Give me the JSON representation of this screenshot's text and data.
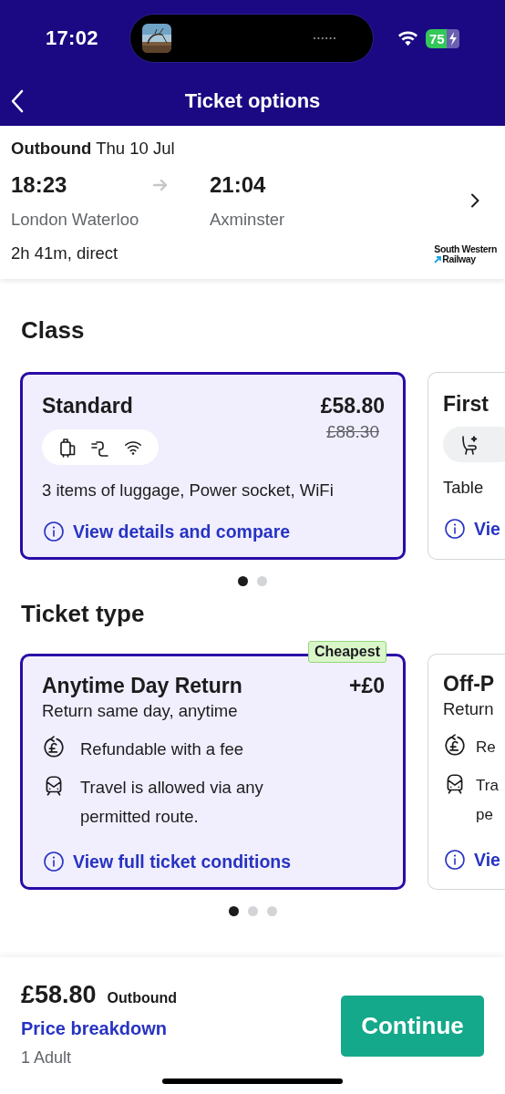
{
  "status_bar": {
    "time": "17:02",
    "battery": "75"
  },
  "header": {
    "title": "Ticket options"
  },
  "journey": {
    "heading": "**Outbound** Thu 10 Jul",
    "depart_time": "18:23",
    "arrive_time": "21:04",
    "origin": "London Waterloo",
    "destination": "Axminster",
    "summary": "2h 41m, direct",
    "operator_lines": [
      "South Western",
      "Railway"
    ]
  },
  "class_section": {
    "title": "Class",
    "cards": [
      {
        "selected": true,
        "name": "Standard",
        "price": "£58.80",
        "old_price": "£88.30",
        "amenities": [
          {
            "kind": "luggage"
          },
          {
            "kind": "power"
          },
          {
            "kind": "wifi"
          }
        ],
        "features": "3 items of luggage, Power socket, WiFi",
        "link": "View details and compare"
      },
      {
        "selected": false,
        "name": "First",
        "amenities": [
          {
            "kind": "seat"
          }
        ],
        "features": "Table",
        "link": "Vie"
      }
    ],
    "pager": [
      {
        "selected": true
      },
      {
        "selected": false
      }
    ]
  },
  "ticket_section": {
    "title": "Ticket type",
    "cards": [
      {
        "selected": true,
        "badge": "Cheapest",
        "name": "Anytime Day Return",
        "price": "+£0",
        "subtitle": "Return same day, anytime",
        "conditions": [
          {
            "kind": "refund",
            "text": "Refundable with a fee"
          },
          {
            "kind": "route",
            "text": "Travel is allowed via any permitted route."
          }
        ],
        "link": "View full ticket conditions"
      },
      {
        "selected": false,
        "name": "Off-P",
        "subtitle": "Return",
        "conditions": [
          {
            "kind": "refund",
            "text": "Re"
          },
          {
            "kind": "route",
            "text": "Tra pe"
          }
        ],
        "link": "Vie"
      }
    ],
    "pager": [
      {
        "selected": true
      },
      {
        "selected": false
      },
      {
        "selected": false
      }
    ]
  },
  "footer": {
    "price": "£58.80",
    "direction": "Outbound",
    "breakdown_link": "Price breakdown",
    "passengers": "1 Adult",
    "button": "Continue"
  }
}
